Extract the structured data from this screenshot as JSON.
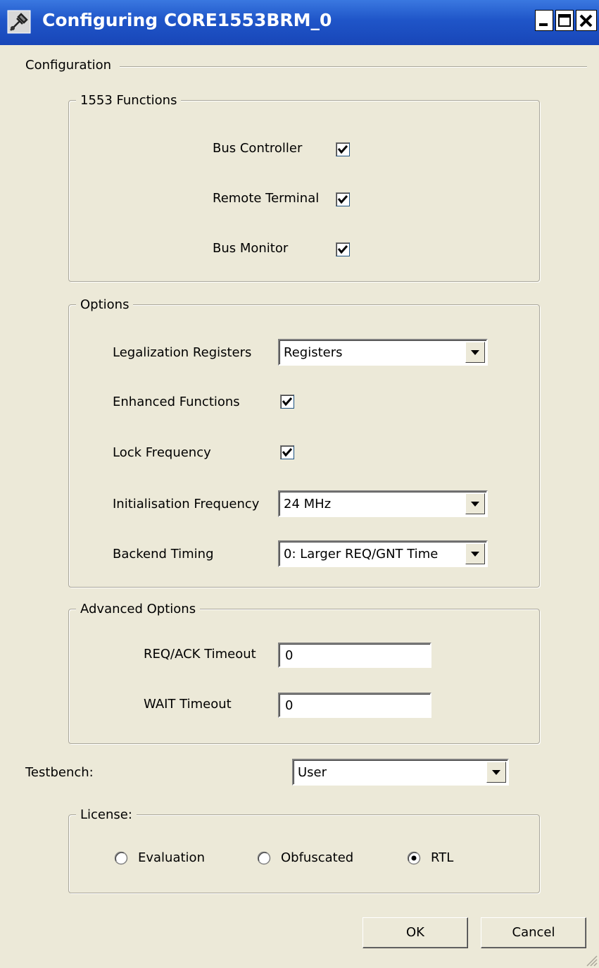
{
  "window": {
    "title": "Configuring CORE1553BRM_0"
  },
  "configuration": {
    "label": "Configuration"
  },
  "functions": {
    "legend": "1553 Functions",
    "items": [
      {
        "label": "Bus Controller",
        "checked": true
      },
      {
        "label": "Remote Terminal",
        "checked": true
      },
      {
        "label": "Bus Monitor",
        "checked": true
      }
    ]
  },
  "options": {
    "legend": "Options",
    "legalization": {
      "label": "Legalization Registers",
      "value": "Registers"
    },
    "enhanced": {
      "label": "Enhanced Functions",
      "checked": true
    },
    "lock_frequency": {
      "label": "Lock Frequency",
      "checked": true
    },
    "init_frequency": {
      "label": "Initialisation Frequency",
      "value": "24 MHz"
    },
    "backend_timing": {
      "label": "Backend Timing",
      "value": "0: Larger REQ/GNT Time"
    }
  },
  "advanced": {
    "legend": "Advanced Options",
    "req_ack": {
      "label": "REQ/ACK Timeout",
      "value": "0"
    },
    "wait": {
      "label": "WAIT Timeout",
      "value": "0"
    }
  },
  "testbench": {
    "label": "Testbench:",
    "value": "User"
  },
  "license": {
    "legend": "License:",
    "options": [
      {
        "label": "Evaluation",
        "selected": false
      },
      {
        "label": "Obfuscated",
        "selected": false
      },
      {
        "label": "RTL",
        "selected": true
      }
    ]
  },
  "buttons": {
    "ok": "OK",
    "cancel": "Cancel"
  }
}
